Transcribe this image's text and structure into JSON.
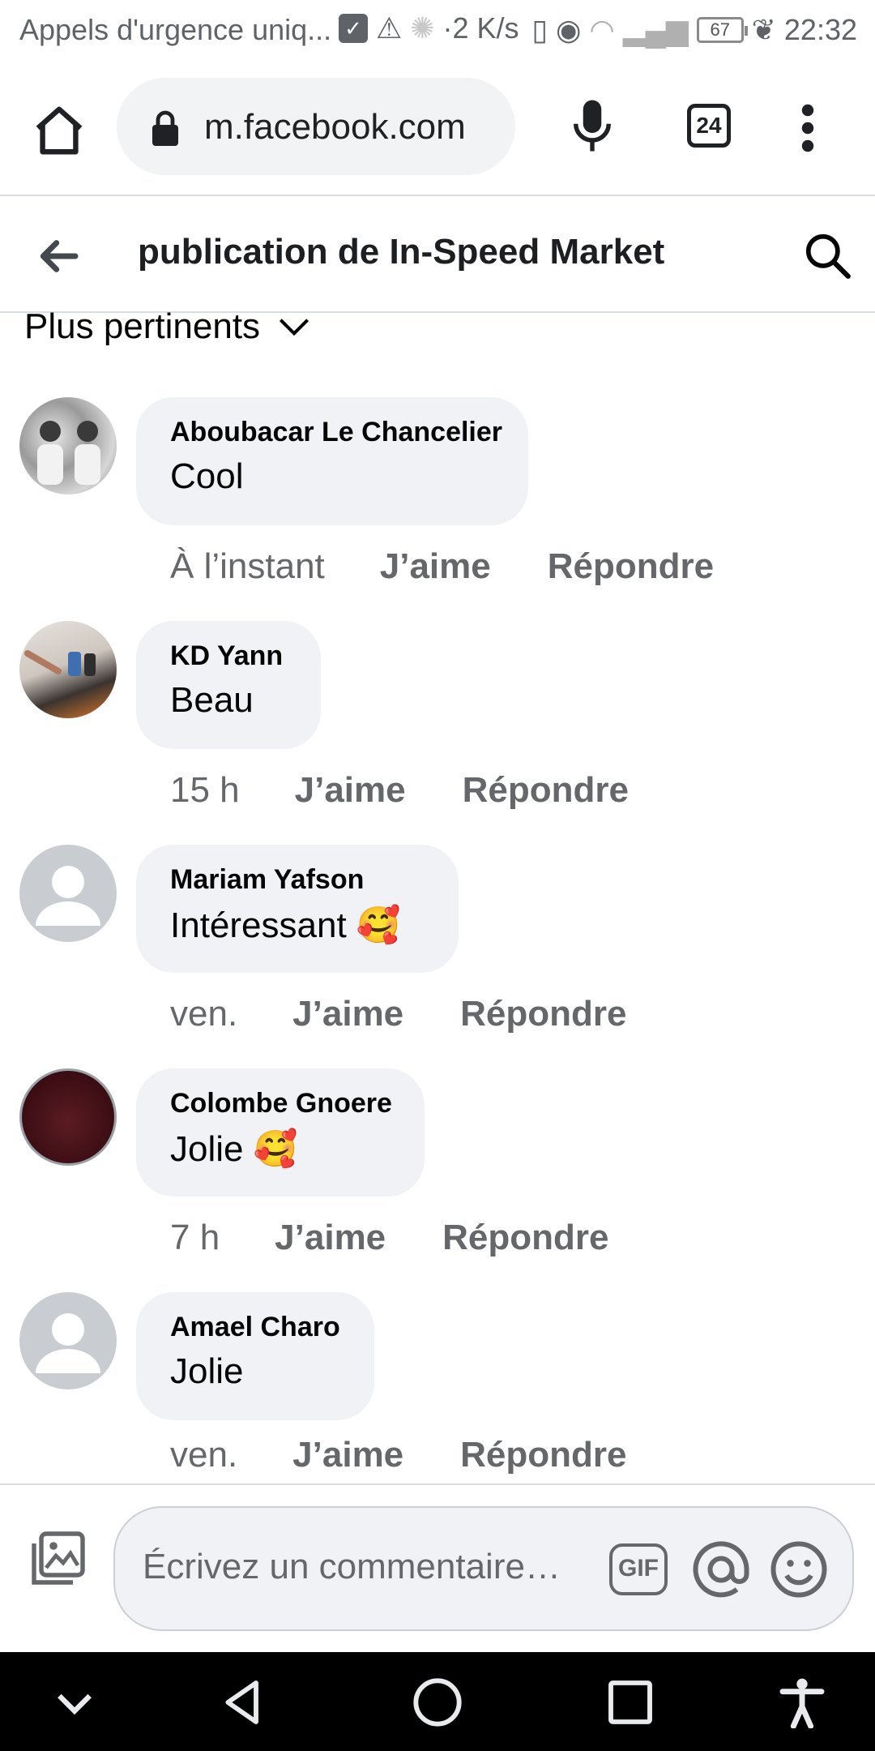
{
  "status_bar": {
    "carrier_text": "Appels d'urgence uniq...",
    "network_speed": "·2 K/s",
    "battery_level": "67",
    "time": "22:32"
  },
  "browser": {
    "url": "m.facebook.com",
    "tab_count": "24"
  },
  "header": {
    "title": "publication de In-Speed Market"
  },
  "sort": {
    "label": "Plus pertinents"
  },
  "comments": [
    {
      "name": "Aboubacar Le Chancelier",
      "text": "Cool",
      "time": "À l’instant",
      "like": "J’aime",
      "reply": "Répondre",
      "avatar": "photo"
    },
    {
      "name": "KD Yann",
      "text": "Beau",
      "time": "15 h",
      "like": "J’aime",
      "reply": "Répondre",
      "avatar": "photo"
    },
    {
      "name": "Mariam Yafson",
      "text": "Intéressant 🥰",
      "time": "ven.",
      "like": "J’aime",
      "reply": "Répondre",
      "avatar": "default"
    },
    {
      "name": "Colombe Gnoere",
      "text": "Jolie 🥰",
      "time": "7 h",
      "like": "J’aime",
      "reply": "Répondre",
      "avatar": "photo"
    },
    {
      "name": "Amael Charo",
      "text": "Jolie",
      "time": "ven.",
      "like": "J’aime",
      "reply": "Répondre",
      "avatar": "default"
    }
  ],
  "composer": {
    "placeholder": "Écrivez un commentaire…",
    "gif_label": "GIF"
  },
  "colors": {
    "bubble_bg": "#f0f2f5",
    "secondary_text": "#65676b",
    "nav_bar": "#000000"
  }
}
